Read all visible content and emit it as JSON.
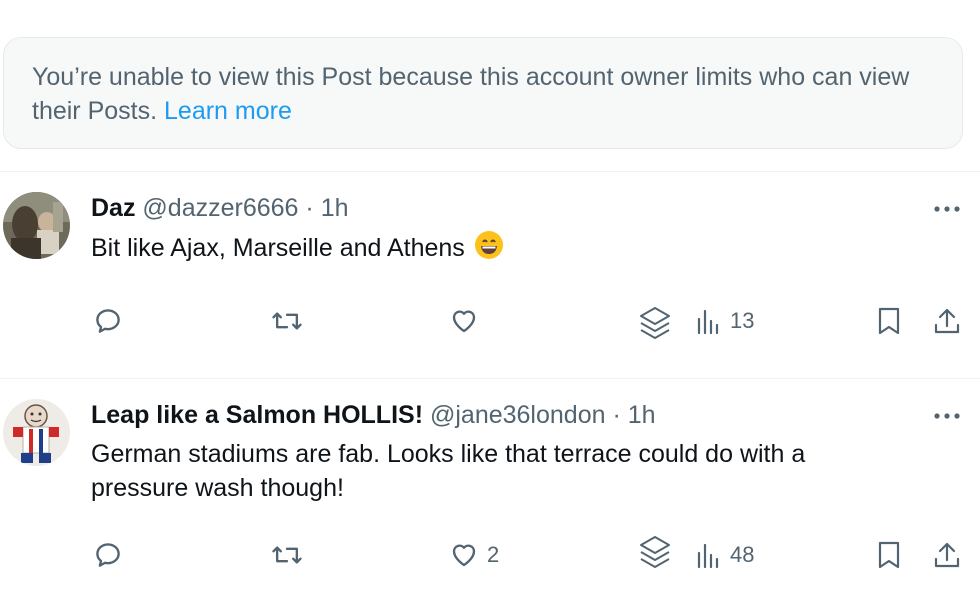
{
  "notice": {
    "text": "You’re unable to view this Post because this account owner limits who can view their Posts.",
    "link": "Learn more"
  },
  "posts": [
    {
      "name": "Daz",
      "handle": "@dazzer6666",
      "sep": "·",
      "time": "1h",
      "text": "Bit like Ajax, Marseille and Athens",
      "emoji": "grinning-face",
      "likes": "",
      "views": "13"
    },
    {
      "name": "Leap like a Salmon HOLLIS!",
      "handle": "@jane36london",
      "sep": "·",
      "time": "1h",
      "text": "German stadiums are fab. Looks like that terrace could do with a pressure wash though!",
      "likes": "2",
      "views": "48"
    }
  ],
  "colors": {
    "muted": "#536471",
    "link": "#1d9bf0",
    "text": "#0f1419",
    "notice_bg": "#f7f9f9"
  }
}
